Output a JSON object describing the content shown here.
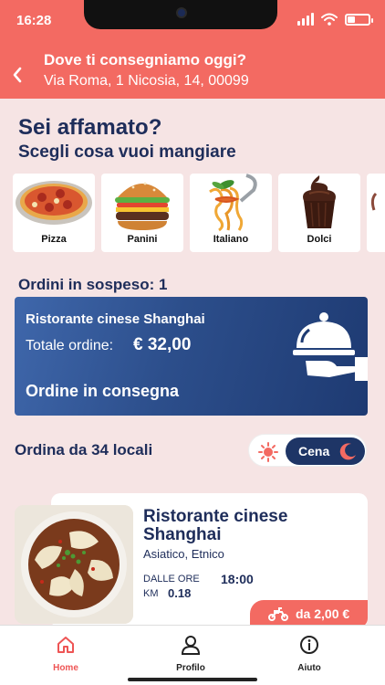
{
  "status_bar": {
    "time": "16:28"
  },
  "header": {
    "question": "Dove ti consegniamo oggi?",
    "address": "Via Roma, 1 Nicosia, 14, 00099",
    "back_icon": "chevron-left-icon"
  },
  "hero": {
    "title": "Sei affamato?",
    "subtitle": "Scegli cosa vuoi mangiare"
  },
  "categories": [
    {
      "label": "Pizza",
      "icon": "pizza-icon"
    },
    {
      "label": "Panini",
      "icon": "burger-icon"
    },
    {
      "label": "Italiano",
      "icon": "pasta-icon"
    },
    {
      "label": "Dolci",
      "icon": "cupcake-icon"
    }
  ],
  "pending": {
    "title": "Ordini in sospeso: 1",
    "restaurant": "Ristorante cinese Shanghai",
    "total_label": "Totale ordine:",
    "total_value": "€ 32,00",
    "status": "Ordine in consegna",
    "icon": "cloche-serving-icon"
  },
  "order_from": {
    "title": "Ordina da 34 locali",
    "toggle": {
      "selected": "Cena",
      "left_icon": "sun-icon",
      "right_icon": "moon-icon"
    }
  },
  "restaurant_card": {
    "name": "Ristorante cinese Shanghai",
    "cuisine": "Asiatico, Etnico",
    "hours_label": "DALLE ORE",
    "hours_value": "18:00",
    "km_label": "KM",
    "km_value": "0.18",
    "delivery_icon": "scooter-icon",
    "delivery_value": "da 2,00 €"
  },
  "bottom_nav": [
    {
      "label": "Home",
      "icon": "home-icon",
      "active": true
    },
    {
      "label": "Profilo",
      "icon": "user-icon",
      "active": false
    },
    {
      "label": "Aiuto",
      "icon": "info-icon",
      "active": false
    }
  ],
  "colors": {
    "accent": "#f36a62",
    "navy": "#1e2d5a",
    "background": "#f6e4e4"
  }
}
